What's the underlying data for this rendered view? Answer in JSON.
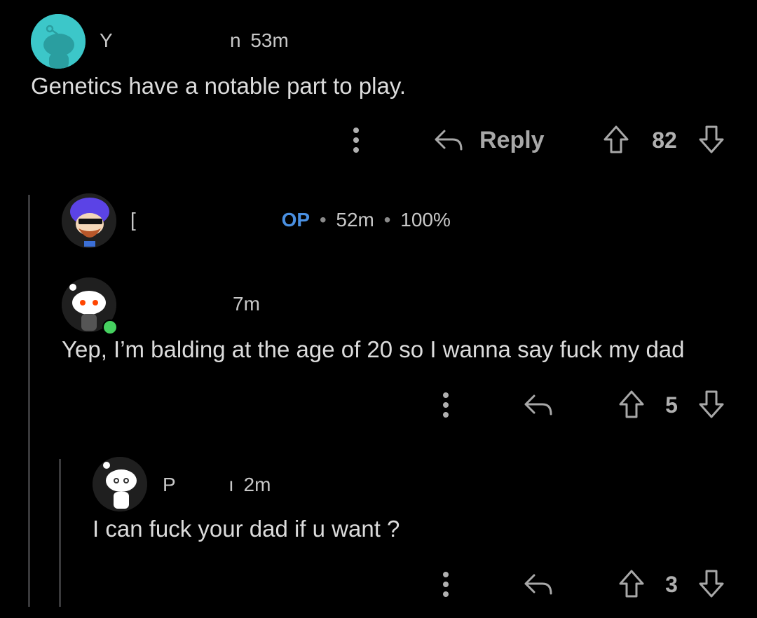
{
  "comments": [
    {
      "username": "Y",
      "username_tail": "n",
      "age": "53m",
      "body": "Genetics have a notable part to play.",
      "reply_label": "Reply",
      "votes": "82"
    },
    {
      "username": "[",
      "op_badge": "OP",
      "age": "52m",
      "upvote_ratio": "100%"
    },
    {
      "username": "",
      "age": "7m",
      "body": "Yep, I’m balding at the age of 20 so I wanna say fuck my dad",
      "votes": "5",
      "online_color": "#46d160"
    },
    {
      "username": "P",
      "username_tail": "ı",
      "age": "2m",
      "body": "I can fuck your dad if u want ?",
      "votes": "3"
    }
  ],
  "icons": {
    "more": "more-vertical-icon",
    "reply": "reply-arrow-icon",
    "upvote": "upvote-arrow-icon",
    "downvote": "downvote-arrow-icon"
  },
  "colors": {
    "background": "#000000",
    "op_badge": "#4a90e2",
    "thread_line": "#3a3a3c"
  }
}
